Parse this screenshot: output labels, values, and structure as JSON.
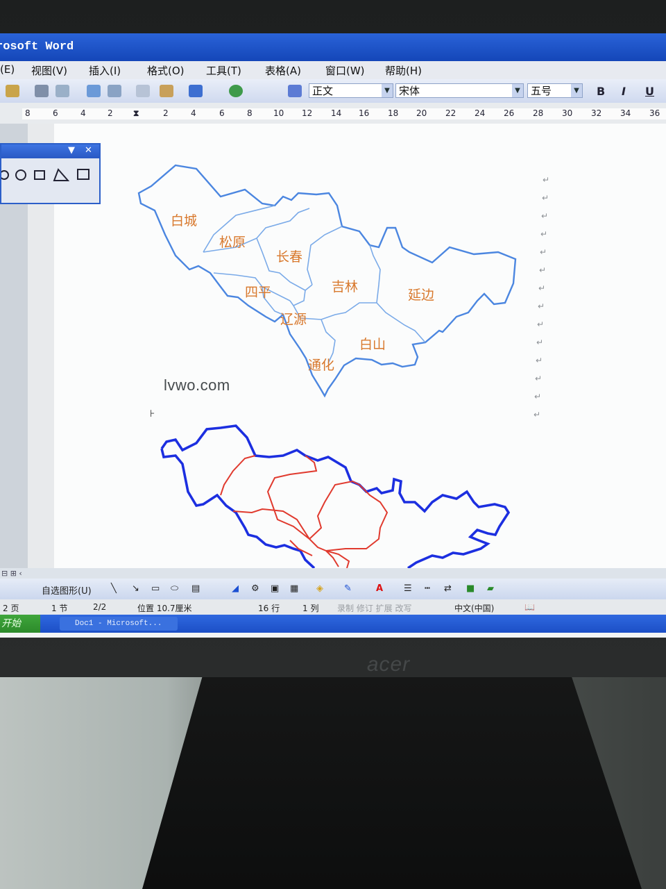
{
  "window": {
    "title": "rosoft Word"
  },
  "menu": {
    "items": [
      "(E)",
      "视图(V)",
      "插入(I)",
      "格式(O)",
      "工具(T)",
      "表格(A)",
      "窗口(W)",
      "帮助(H)"
    ]
  },
  "toolbar": {
    "style_value": "正文",
    "font_value": "宋体",
    "size_value": "五号",
    "bold_label": "B",
    "italic_label": "I",
    "underline_label": "U"
  },
  "ruler": {
    "left_numbers": [
      "8",
      "6",
      "4",
      "2"
    ],
    "right_numbers": [
      "2",
      "4",
      "6",
      "8",
      "10",
      "12",
      "14",
      "16",
      "18",
      "20",
      "22",
      "24",
      "26",
      "28",
      "30",
      "32",
      "34",
      "36"
    ]
  },
  "document": {
    "map_labels": [
      "白城",
      "松原",
      "长春",
      "四平",
      "吉林",
      "延边",
      "辽源",
      "白山",
      "通化"
    ],
    "watermark": "lvwo.com",
    "outline_color": "#1c2fe0",
    "border_color": "#e03a2e",
    "label_color": "#d8782c"
  },
  "drawing_toolbar": {
    "autoshapes_label": "自选图形(U)"
  },
  "status": {
    "page": "2 页",
    "section": "1 节",
    "page_of": "2/2",
    "position": "位置 10.7厘米",
    "line": "16 行",
    "column": "1 列",
    "modes": "录制 修订 扩展 改写",
    "language": "中文(中国)"
  },
  "taskbar": {
    "start_label": "开始",
    "task_label": "Doc1 - Microsoft..."
  },
  "monitor": {
    "brand": "acer"
  }
}
